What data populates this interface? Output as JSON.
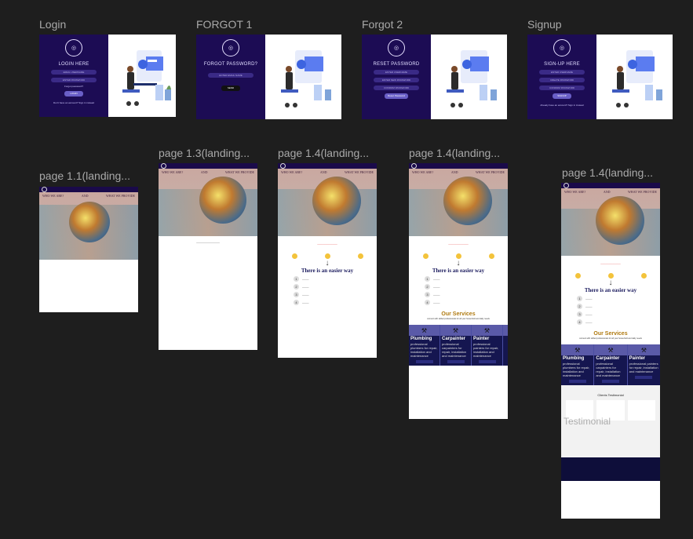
{
  "canvas": {
    "background": "#1e1e1e"
  },
  "frames": {
    "login": {
      "label": "Login",
      "title": "LOGIN HERE",
      "inputs": [
        "EMAIL USERNAME",
        "ENTER PASSWORD"
      ],
      "forgot": "Forgot password?",
      "button": "LOGIN",
      "footer": "Don't have an account? Sign in instead"
    },
    "forgot1": {
      "label": "FORGOT 1",
      "title": "FORGOT PASSWORD?",
      "inputs": [
        "ENTER EMAIL NAME"
      ],
      "button": "SEND"
    },
    "forgot2": {
      "label": "Forgot 2",
      "title": "RESET PASSWORD",
      "inputs": [
        "ENTER USERNAME",
        "ENTER NEW PASSWORD",
        "CONFIRM PASSWORD"
      ],
      "button": "Reset Password"
    },
    "signup": {
      "label": "Signup",
      "title": "SIGN-UP HERE",
      "inputs": [
        "ENTER USERNAME",
        "CREATE PASSWORD",
        "CONFIRM PASSWORD"
      ],
      "button": "SIGNUP",
      "footer": "Already have an account? Sign in instead"
    },
    "page11": {
      "label": "page 1.1(landing..."
    },
    "page13": {
      "label": "page 1.3(landing..."
    },
    "page14a": {
      "label": "page 1.4(landing..."
    },
    "page14b": {
      "label": "page 1.4(landing..."
    },
    "page14c": {
      "label": "page 1.4(landing..."
    }
  },
  "landing": {
    "hero_left": "WHO WE ARE?",
    "hero_mid": "AND",
    "hero_right": "WHAT WE PROVIDE",
    "easier": "There is an easier way",
    "services_title": "Our Services",
    "services_sub": "connect with skilled professionals for all your household and daily needs",
    "services": [
      {
        "name": "Plumbing",
        "desc": "professional plumbers for repair, installation and maintenance"
      },
      {
        "name": "Carpainter",
        "desc": "professional carpainters for repair, installation and maintenance"
      },
      {
        "name": "Painter",
        "desc": "professional painters for repair, installation and maintenance"
      }
    ],
    "testimonial_title": "Clients Testimonial",
    "testimonial_ghost": "Testimonial"
  },
  "colors": {
    "label": "#a9a9a9",
    "auth_panel": "#1c0c54",
    "services_card": "#151650",
    "services_title": "#b07a10"
  }
}
